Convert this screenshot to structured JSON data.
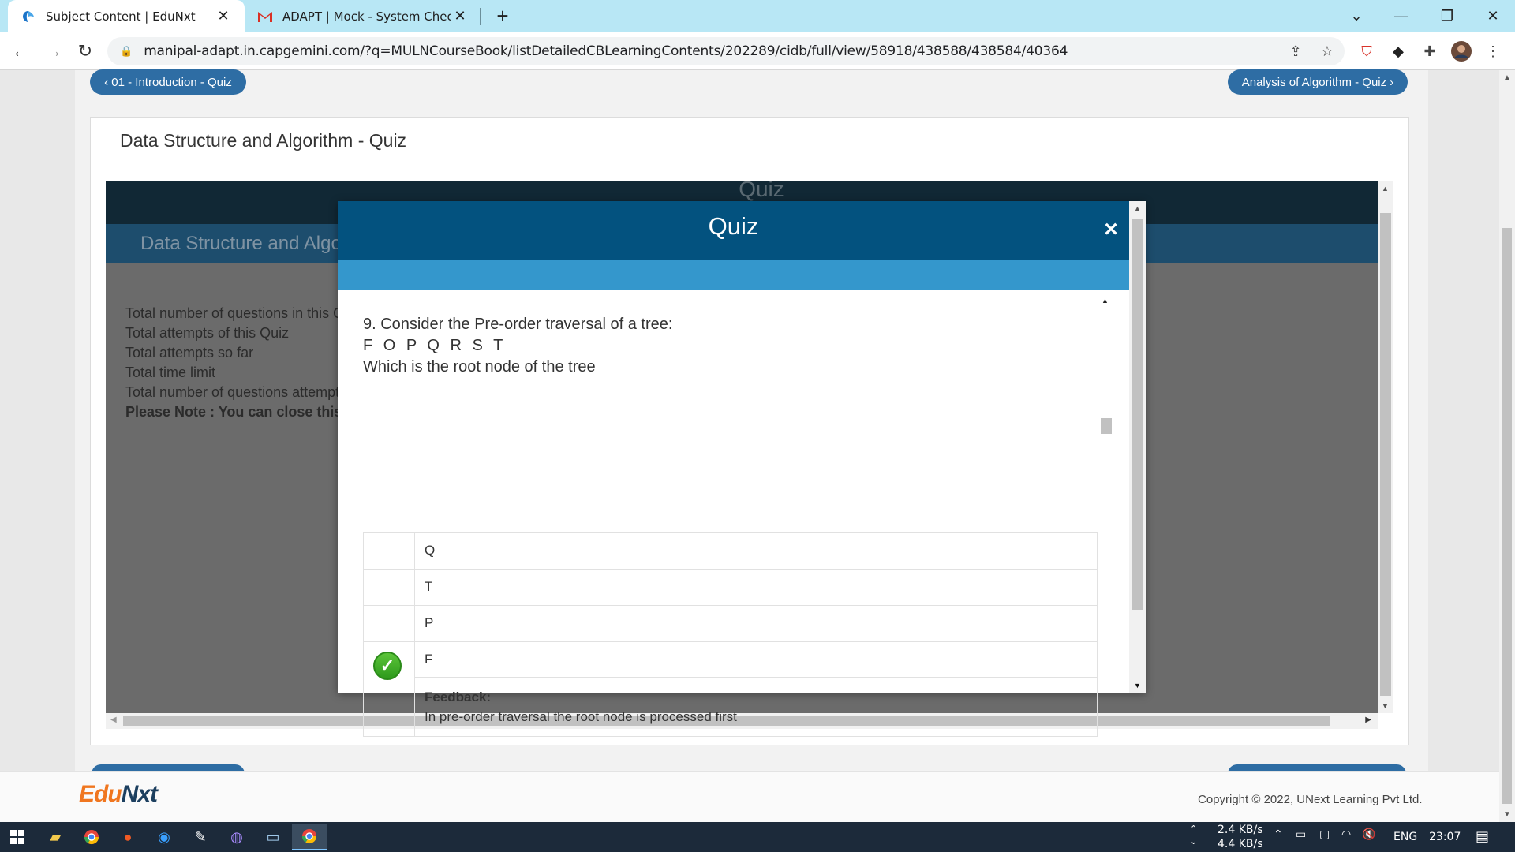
{
  "browser": {
    "tabs": [
      {
        "title": "Subject Content | EduNxt",
        "active": true
      },
      {
        "title": "ADAPT | Mock - System Check As",
        "active": false
      }
    ],
    "url": "manipal-adapt.in.capgemini.com/?q=MULNCourseBook/listDetailedCBLearningContents/202289/cidb/full/view/58918/438588/438584/40364"
  },
  "page": {
    "prev_button": "‹ 01 - Introduction - Quiz",
    "next_button": "Analysis of Algorithm - Quiz ›",
    "card_title": "Data Structure and Algorithm - Quiz",
    "iframe": {
      "top_title": "Quiz",
      "band_title": "Data Structure and Algorithm - Quiz",
      "info_lines": [
        "Total number of questions in this Quiz",
        "Total attempts of this Quiz",
        "Total attempts so far",
        "Total time limit",
        "Total number of questions attempted"
      ],
      "note": "Please Note : You can close this window"
    }
  },
  "modal": {
    "title": "Quiz",
    "close_icon": "×",
    "question": {
      "line1": "9. Consider the Pre-order traversal of a tree:",
      "line2": "F O P Q R S T",
      "line3": "Which is the root node of the tree"
    },
    "options": [
      {
        "label": "Q",
        "correct": false
      },
      {
        "label": "T",
        "correct": false
      },
      {
        "label": "P",
        "correct": false
      },
      {
        "label": "F",
        "correct": true
      }
    ],
    "feedback_heading": "Feedback:",
    "feedback_text": "In pre-order traversal the root node is processed first"
  },
  "footer": {
    "logo_edu": "Edu",
    "logo_nxt": "Nxt",
    "copyright": "Copyright © 2022, UNext Learning Pvt Ltd."
  },
  "taskbar": {
    "net_up": "2.4 KB/s",
    "net_down": "4.4 KB/s",
    "lang": "ENG",
    "time": "23:07"
  },
  "colors": {
    "tabstrip": "#b8e7f5",
    "modal_header": "#03527f",
    "modal_band": "#3497cc",
    "pill": "#2e6da4",
    "correct": "#3db02a"
  }
}
